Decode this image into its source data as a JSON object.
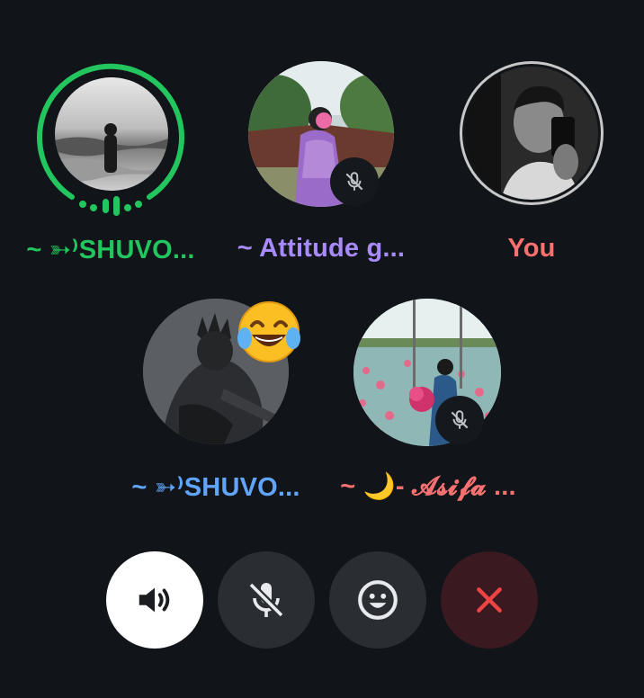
{
  "participants": [
    {
      "name": "~ ➳⁾SHUVO...",
      "color": "#22c55e",
      "speaking": true,
      "muted": false,
      "avatar": "person-in-grayscale-landscape"
    },
    {
      "name": "~ Attitude g...",
      "color": "#a78bfa",
      "speaking": false,
      "muted": true,
      "avatar": "woman-in-purple-saree"
    },
    {
      "name": "You",
      "color": "#f87171",
      "speaking": false,
      "muted": false,
      "avatar": "man-mirror-selfie"
    },
    {
      "name": "~ ➳⁾SHUVO...",
      "color": "#60a5fa",
      "speaking": false,
      "muted": false,
      "avatar": "dark-armored-figure",
      "reaction": "tears-of-joy-emoji"
    },
    {
      "name": "~ 🌙- 𝓐𝓼𝓲𝓯𝓪 ...",
      "color": "#f87171",
      "speaking": false,
      "muted": true,
      "avatar": "girl-in-lotus-pond"
    }
  ],
  "controls": {
    "speaker": {
      "icon": "speaker-icon",
      "active": true
    },
    "mic": {
      "icon": "mic-off-icon",
      "active": false
    },
    "reaction": {
      "icon": "smiley-icon",
      "active": false
    },
    "end_call": {
      "icon": "close-icon",
      "color": "#ef4444"
    }
  },
  "colors": {
    "background": "#111418",
    "speaking_ring": "#22c55e",
    "button_bg": "#2a2d32",
    "end_button_bg": "#3a1a20"
  }
}
